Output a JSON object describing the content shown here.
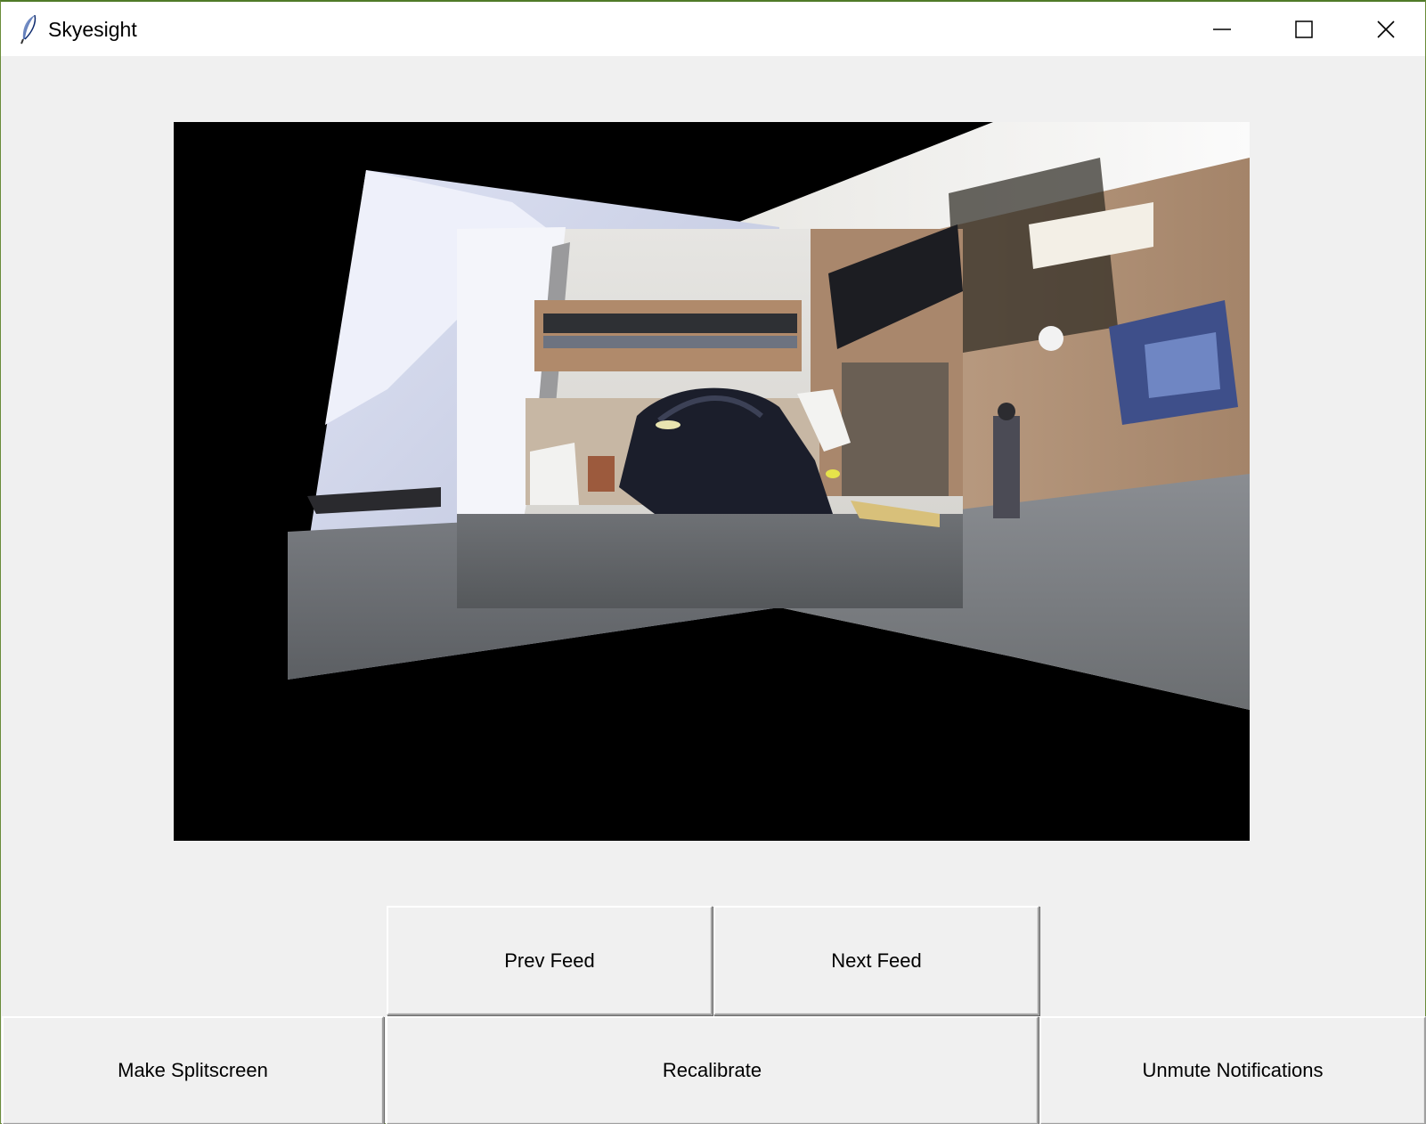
{
  "window": {
    "title": "Skyesight"
  },
  "controls": {
    "prev_feed": "Prev Feed",
    "next_feed": "Next Feed",
    "make_splitscreen": "Make Splitscreen",
    "recalibrate": "Recalibrate",
    "unmute_notifications": "Unmute Notifications"
  },
  "icons": {
    "app": "feather-icon",
    "minimize": "minimize-icon",
    "maximize": "maximize-icon",
    "close": "close-icon"
  },
  "colors": {
    "window_bg": "#f0f0f0",
    "titlebar_bg": "#ffffff",
    "feed_bg": "#000000"
  }
}
